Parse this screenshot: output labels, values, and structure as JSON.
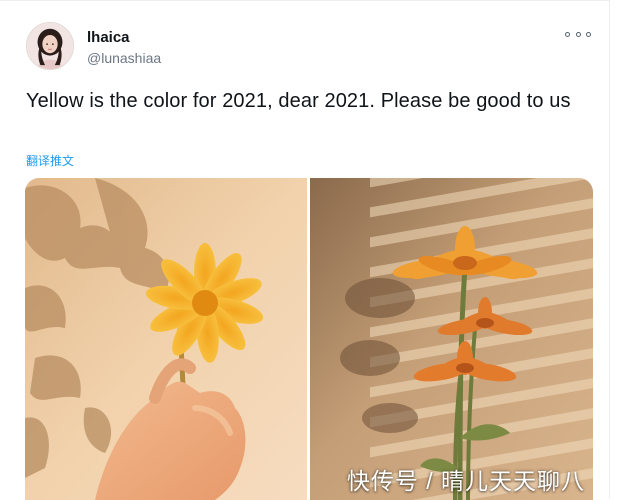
{
  "tweet": {
    "author": {
      "display_name": "lhaica",
      "handle": "@lunashiaa"
    },
    "text": "Yellow is the color for 2021, dear 2021. Please be good to us",
    "translate_label": "翻译推文",
    "more_icon": "more-horizontal-icon"
  },
  "watermark": "快传号 / 晴儿天天聊八",
  "colors": {
    "accent": "#1d9bf0",
    "text": "#0f1419",
    "secondary_text": "#6b7785"
  }
}
